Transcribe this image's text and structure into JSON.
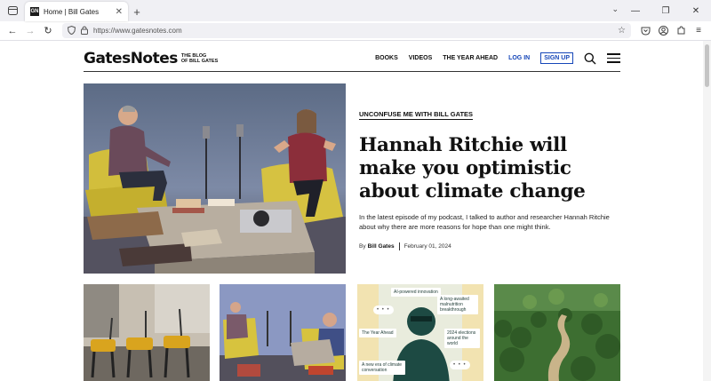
{
  "browser": {
    "tab_title": "Home | Bill Gates",
    "tab_favicon": "GN",
    "url": "https://www.gatesnotes.com"
  },
  "site": {
    "logo": "GatesNotes",
    "tagline_line1": "THE BLOG",
    "tagline_line2": "OF BILL GATES",
    "nav": {
      "books": "BOOKS",
      "videos": "VIDEOS",
      "year_ahead": "THE YEAR AHEAD",
      "login": "LOG IN",
      "signup": "SIGN UP"
    }
  },
  "hero": {
    "kicker": "UNCONFUSE ME WITH BILL GATES",
    "headline": "Hannah Ritchie will make you optimistic about climate change",
    "dek": "In the latest episode of my podcast, I talked to author and researcher Hannah Ritchie about why there are more reasons for hope than one might think.",
    "by_prefix": "By",
    "author": "Bill Gates",
    "date": "February 01, 2024"
  },
  "cards": {
    "year_ahead_labels": {
      "ai": "AI-powered innovation",
      "malnutrition": "A long-awaited malnutrition breakthrough",
      "year_ahead": "The Year Ahead",
      "elections": "2024 elections around the world",
      "climate": "A new era of climate conversation"
    }
  },
  "colors": {
    "link_blue": "#1546b8",
    "text": "#111111"
  }
}
